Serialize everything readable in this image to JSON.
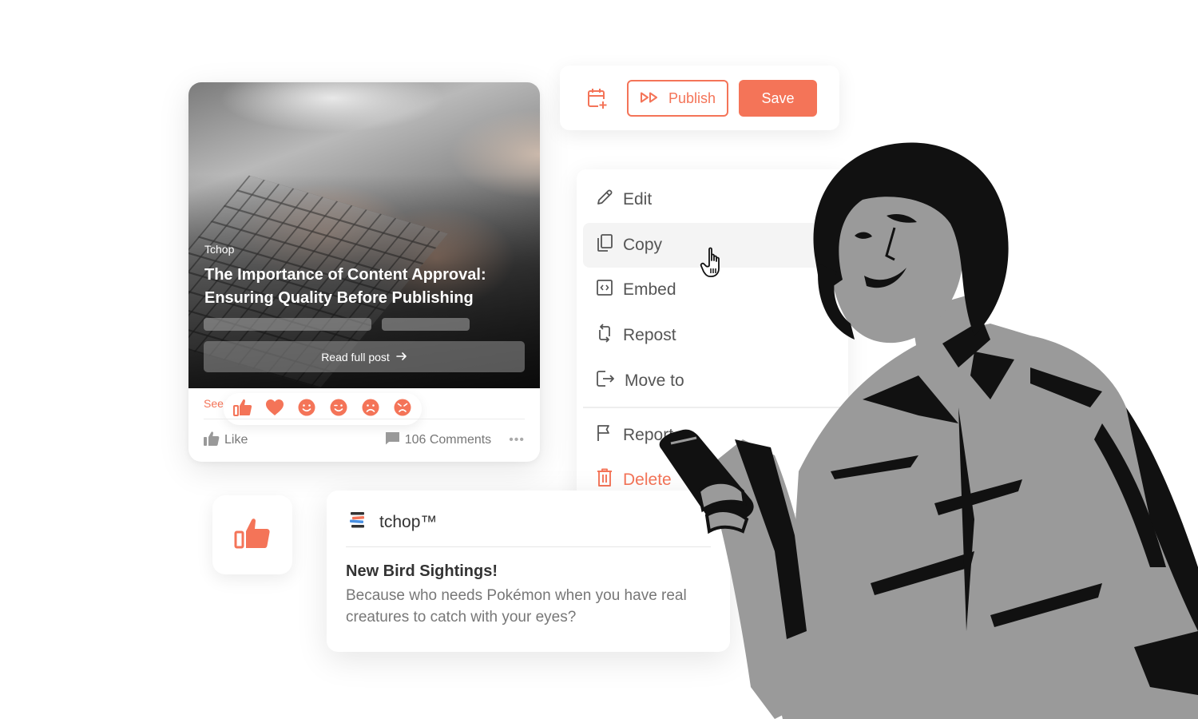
{
  "brand": {
    "accent": "#f47458",
    "muted_text": "#777777",
    "dark_text": "#333333"
  },
  "post_card": {
    "source": "Tchop",
    "title": "The Importance of Content Approval: Ensuring Quality Before Publishing",
    "read_button": "Read full post",
    "see_link": "See",
    "reactions": [
      "thumbs-up",
      "heart",
      "smile",
      "wink",
      "sad",
      "angry"
    ],
    "like_label": "Like",
    "comments_label": "106 Comments",
    "more_label": "•••"
  },
  "toolbar": {
    "schedule_icon": "calendar-plus-icon",
    "publish_label": "Publish",
    "save_label": "Save"
  },
  "menu": {
    "items": [
      {
        "label": "Edit",
        "icon": "pencil-icon"
      },
      {
        "label": "Copy",
        "icon": "copy-icon",
        "hovered": true
      },
      {
        "label": "Embed",
        "icon": "embed-code-icon"
      },
      {
        "label": "Repost",
        "icon": "repost-icon"
      },
      {
        "label": "Move to",
        "icon": "move-to-icon"
      },
      {
        "label": "Report",
        "icon": "flag-icon"
      },
      {
        "label": "Delete",
        "icon": "trash-icon",
        "danger": true
      }
    ]
  },
  "notification": {
    "app_name": "tchop™",
    "title": "New Bird Sightings!",
    "body": "Because who needs Pokémon when you have real creatures to catch with your eyes?"
  }
}
